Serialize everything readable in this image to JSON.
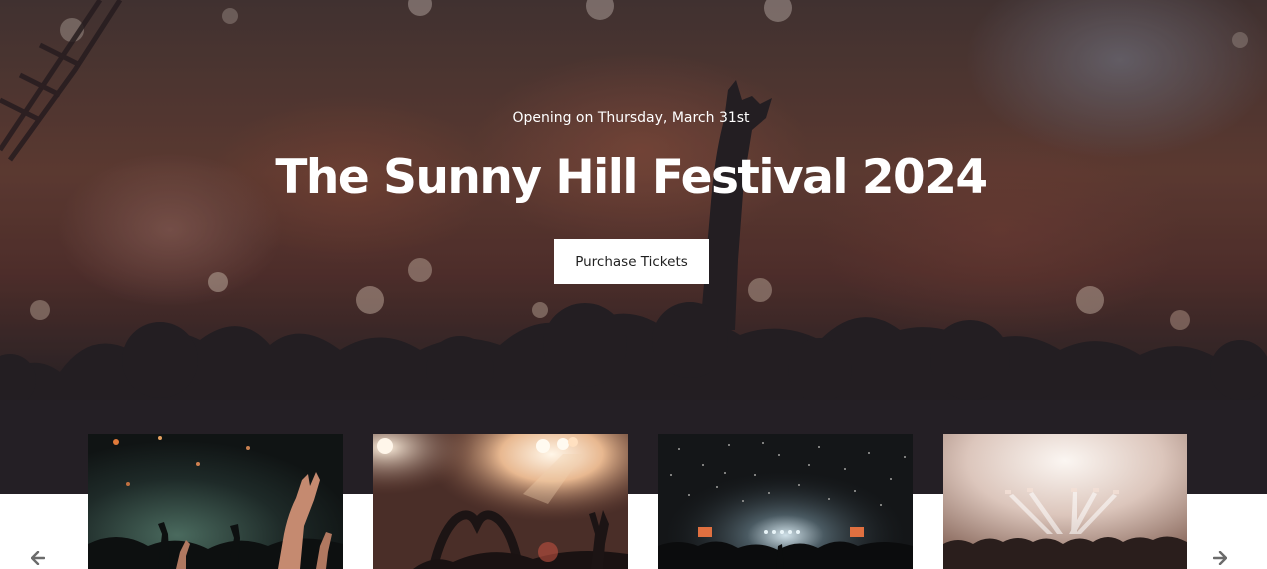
{
  "hero": {
    "subtitle": "Opening on Thursday, March 31st",
    "title": "The Sunny Hill Festival 2024",
    "cta_label": "Purchase Tickets"
  },
  "carousel": {
    "prev_icon": "arrow-left-icon",
    "next_icon": "arrow-right-icon",
    "slides": [
      {
        "subject": "crowd hands raised under green stage lights"
      },
      {
        "subject": "fan making heart shape with hands in front of stage lights"
      },
      {
        "subject": "confetti falling over concert crowd and stage"
      },
      {
        "subject": "crowd facing brightly lit stage with light beams"
      }
    ]
  },
  "colors": {
    "hero_text": "#ffffff",
    "button_bg": "#ffffff",
    "button_text": "#1f1f1f",
    "arrow": "#6b6b6b"
  }
}
